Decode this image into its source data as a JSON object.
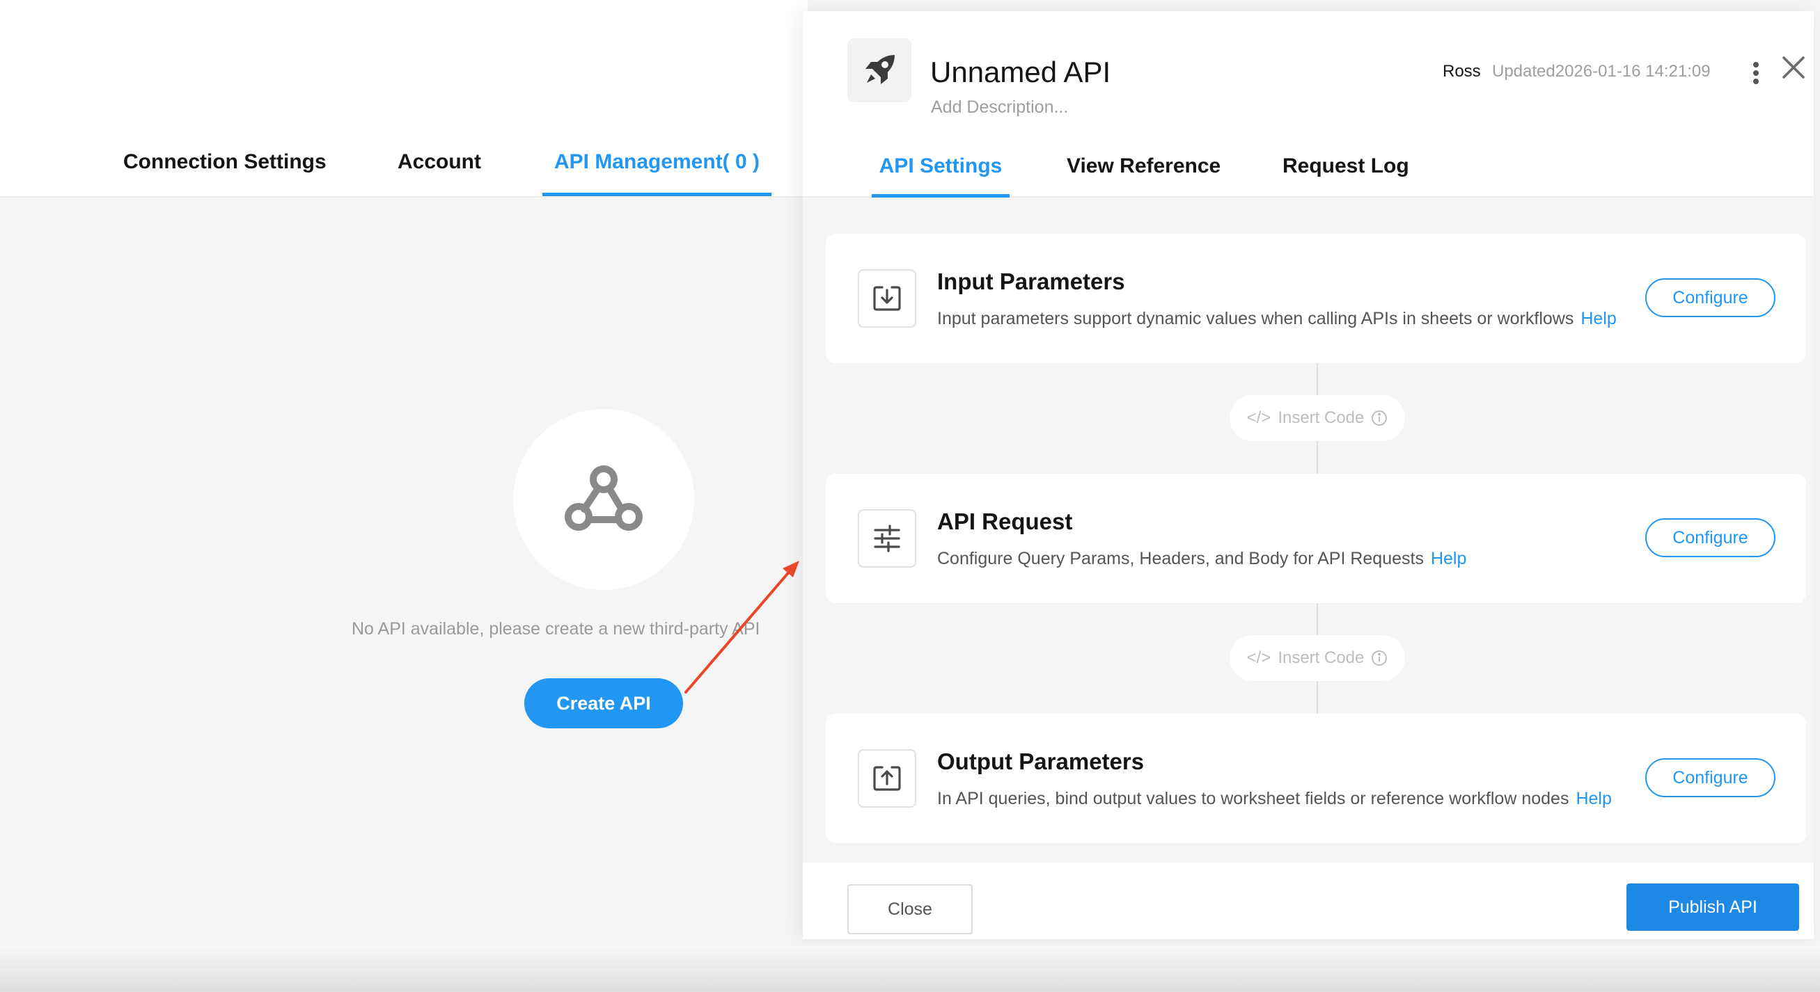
{
  "background_page": {
    "tabs": [
      {
        "label": "Connection Settings"
      },
      {
        "label": "Account"
      },
      {
        "label": "API Management( 0 )",
        "active": true
      }
    ],
    "empty_icon": "webhook-icon",
    "empty_message": "No API available, please create a new third-party API",
    "create_button": "Create API",
    "annotation_arrow_color": "#e8472a"
  },
  "drawer": {
    "icon": "rocket-icon",
    "api_name": "Unnamed API",
    "description_placeholder": "Add Description...",
    "owner": "Ross",
    "updated": "Updated2026-01-16 14:21:09",
    "tabs": [
      {
        "label": "API Settings",
        "active": true
      },
      {
        "label": "View Reference"
      },
      {
        "label": "Request Log"
      }
    ],
    "steps": [
      {
        "icon": "download-box-icon",
        "title": "Input Parameters",
        "description": "Input parameters support dynamic values when calling APIs in sheets or workflows",
        "help": "Help",
        "button": "Configure"
      },
      {
        "icon": "sliders-icon",
        "title": "API Request",
        "description": "Configure Query Params, Headers, and Body for API Requests",
        "help": "Help",
        "button": "Configure"
      },
      {
        "icon": "upload-box-icon",
        "title": "Output Parameters",
        "description": "In API queries, bind output values to worksheet fields or reference workflow nodes",
        "help": "Help",
        "button": "Configure"
      }
    ],
    "insert_code_label": "Insert Code",
    "footer": {
      "close_button": "Close",
      "publish_button": "Publish API"
    }
  },
  "colors": {
    "accent": "#2196f3",
    "publish": "#1e88e5",
    "annotation": "#e8472a"
  }
}
